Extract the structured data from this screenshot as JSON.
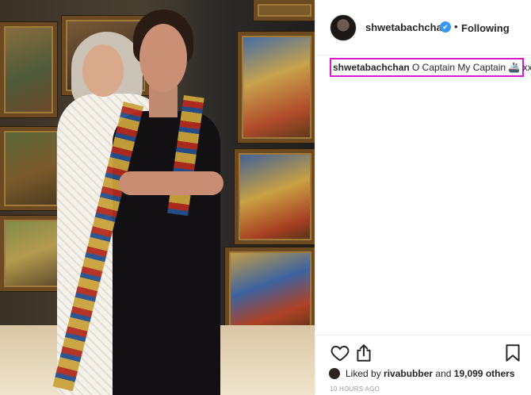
{
  "header": {
    "username": "shwetabachchan",
    "verified_mark": "✔",
    "separator": "•",
    "follow_state": "Following"
  },
  "caption": {
    "username": "shwetabachchan",
    "text": "O Captain My Captain 🚢 xx",
    "highlight_color": "#d61ad3"
  },
  "actions": {
    "like_icon": "heart-outline-icon",
    "share_icon": "share-icon",
    "save_icon": "bookmark-outline-icon"
  },
  "likes": {
    "prefix": "Liked by",
    "liker": "rivabubber",
    "connector": "and",
    "count": "19,099 others"
  },
  "timestamp": "10 HOURS AGO",
  "colors": {
    "verified_blue": "#3897f0",
    "text": "#262626",
    "muted": "#999999"
  }
}
